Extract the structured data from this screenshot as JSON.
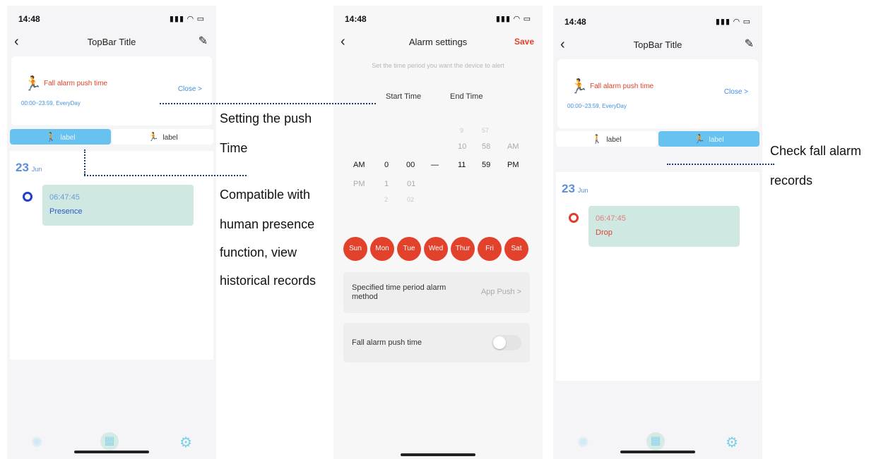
{
  "status_time": "14:48",
  "status_signal": "▮▮▮ ◠ ▭",
  "screen1": {
    "topbar_title": "TopBar Title",
    "card_label": "Fall alarm push time",
    "card_close": "Close >",
    "card_range": "00:00~23:59, EveryDay",
    "tab_left": "label",
    "tab_right": "label",
    "date_day": "23",
    "date_month": "Jun",
    "record_time": "06:47:45",
    "record_status": "Presence"
  },
  "screen2": {
    "title": "Alarm settings",
    "save": "Save",
    "hint": "Set the time period you want the device to alert",
    "start_head": "Start Time",
    "end_head": "End Time",
    "start_ampm": [
      "AM",
      "PM"
    ],
    "start_hour": [
      "0",
      "1",
      "2"
    ],
    "start_min": [
      "00",
      "01",
      "02"
    ],
    "end_hour": [
      "9",
      "10",
      "11"
    ],
    "end_min": [
      "57",
      "58",
      "59"
    ],
    "end_ampm": [
      "AM",
      "PM"
    ],
    "dash": "—",
    "days": [
      "Sun",
      "Mon",
      "Tue",
      "Wed",
      "Thur",
      "Fri",
      "Sat"
    ],
    "method_label": "Specified time period alarm method",
    "method_value": "App Push >",
    "fall_push_label": "Fall alarm push time",
    "fall_push_on": false
  },
  "screen3": {
    "topbar_title": "TopBar Title",
    "card_label": "Fall alarm push time",
    "card_close": "Close >",
    "card_range": "00:00~23:59, EveryDay",
    "tab_left": "label",
    "tab_right": "label",
    "date_day": "23",
    "date_month": "Jun",
    "record_time": "06:47:45",
    "record_status": "Drop"
  },
  "annotations": {
    "push_time_1": "Setting the push",
    "push_time_2": "Time",
    "compat_1": "Compatible with",
    "compat_2": "human presence",
    "compat_3": "function, view",
    "compat_4": "historical records",
    "fall_1": "Check fall alarm",
    "fall_2": "records"
  },
  "colors": {
    "accent_red": "#e2422c",
    "accent_blue": "#67c2ef",
    "record_bg": "#cfe9e2"
  }
}
